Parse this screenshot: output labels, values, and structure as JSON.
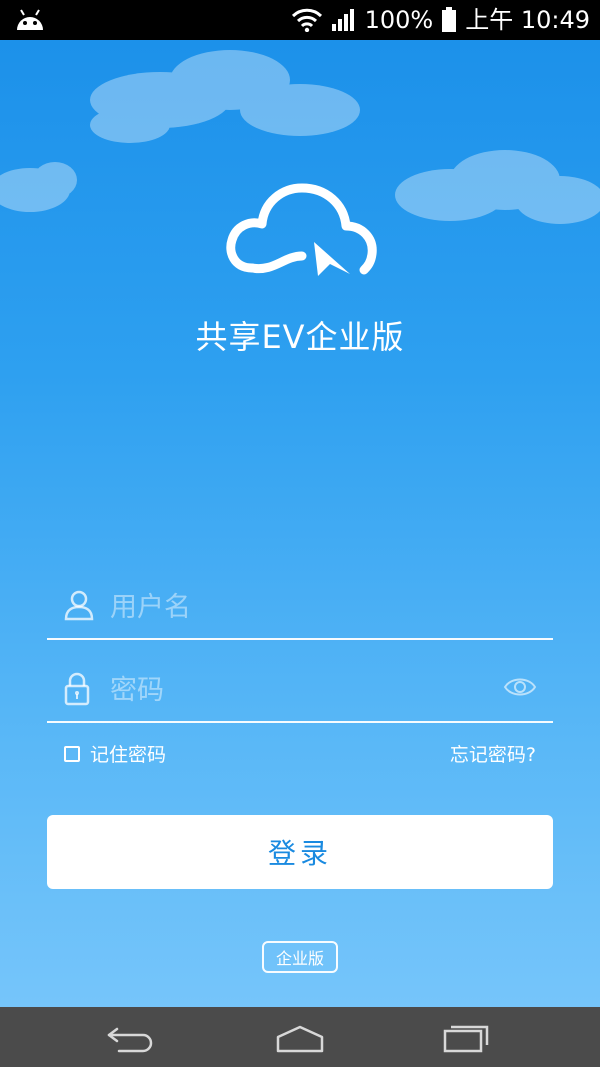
{
  "status_bar": {
    "battery": "100%",
    "time": "上午 10:49"
  },
  "app": {
    "title": "共享EV企业版"
  },
  "login_form": {
    "username_placeholder": "用户名",
    "password_placeholder": "密码",
    "remember_label": "记住密码",
    "forgot_label": "忘记密码?",
    "login_label": "登录",
    "edition_badge": "企业版"
  },
  "icons": {
    "android": "android-icon",
    "wifi": "wifi-icon",
    "signal": "signal-icon",
    "battery": "battery-icon",
    "user": "user-icon",
    "lock": "lock-icon",
    "eye": "eye-icon",
    "back": "back-icon",
    "home": "home-icon",
    "recent": "recent-apps-icon"
  },
  "colors": {
    "primary": "#1a8fe9",
    "button_text": "#1a8ae0",
    "status_bar": "#000000",
    "nav_bar": "#4b4b4b"
  }
}
